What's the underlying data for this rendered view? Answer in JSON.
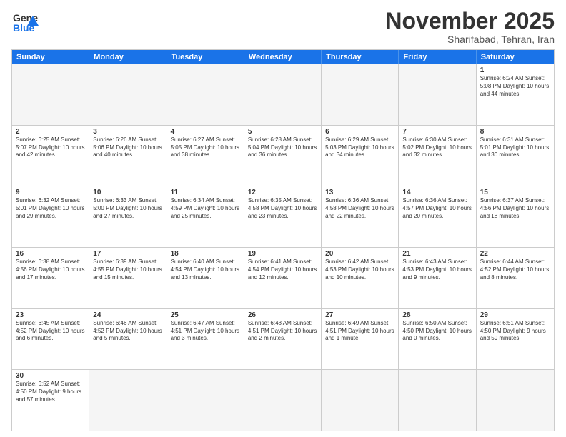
{
  "logo": {
    "line1": "General",
    "line2": "Blue"
  },
  "header": {
    "month": "November 2025",
    "location": "Sharifabad, Tehran, Iran"
  },
  "weekdays": [
    "Sunday",
    "Monday",
    "Tuesday",
    "Wednesday",
    "Thursday",
    "Friday",
    "Saturday"
  ],
  "weeks": [
    [
      {
        "day": "",
        "info": ""
      },
      {
        "day": "",
        "info": ""
      },
      {
        "day": "",
        "info": ""
      },
      {
        "day": "",
        "info": ""
      },
      {
        "day": "",
        "info": ""
      },
      {
        "day": "",
        "info": ""
      },
      {
        "day": "1",
        "info": "Sunrise: 6:24 AM\nSunset: 5:08 PM\nDaylight: 10 hours\nand 44 minutes."
      }
    ],
    [
      {
        "day": "2",
        "info": "Sunrise: 6:25 AM\nSunset: 5:07 PM\nDaylight: 10 hours\nand 42 minutes."
      },
      {
        "day": "3",
        "info": "Sunrise: 6:26 AM\nSunset: 5:06 PM\nDaylight: 10 hours\nand 40 minutes."
      },
      {
        "day": "4",
        "info": "Sunrise: 6:27 AM\nSunset: 5:05 PM\nDaylight: 10 hours\nand 38 minutes."
      },
      {
        "day": "5",
        "info": "Sunrise: 6:28 AM\nSunset: 5:04 PM\nDaylight: 10 hours\nand 36 minutes."
      },
      {
        "day": "6",
        "info": "Sunrise: 6:29 AM\nSunset: 5:03 PM\nDaylight: 10 hours\nand 34 minutes."
      },
      {
        "day": "7",
        "info": "Sunrise: 6:30 AM\nSunset: 5:02 PM\nDaylight: 10 hours\nand 32 minutes."
      },
      {
        "day": "8",
        "info": "Sunrise: 6:31 AM\nSunset: 5:01 PM\nDaylight: 10 hours\nand 30 minutes."
      }
    ],
    [
      {
        "day": "9",
        "info": "Sunrise: 6:32 AM\nSunset: 5:01 PM\nDaylight: 10 hours\nand 29 minutes."
      },
      {
        "day": "10",
        "info": "Sunrise: 6:33 AM\nSunset: 5:00 PM\nDaylight: 10 hours\nand 27 minutes."
      },
      {
        "day": "11",
        "info": "Sunrise: 6:34 AM\nSunset: 4:59 PM\nDaylight: 10 hours\nand 25 minutes."
      },
      {
        "day": "12",
        "info": "Sunrise: 6:35 AM\nSunset: 4:58 PM\nDaylight: 10 hours\nand 23 minutes."
      },
      {
        "day": "13",
        "info": "Sunrise: 6:36 AM\nSunset: 4:58 PM\nDaylight: 10 hours\nand 22 minutes."
      },
      {
        "day": "14",
        "info": "Sunrise: 6:36 AM\nSunset: 4:57 PM\nDaylight: 10 hours\nand 20 minutes."
      },
      {
        "day": "15",
        "info": "Sunrise: 6:37 AM\nSunset: 4:56 PM\nDaylight: 10 hours\nand 18 minutes."
      }
    ],
    [
      {
        "day": "16",
        "info": "Sunrise: 6:38 AM\nSunset: 4:56 PM\nDaylight: 10 hours\nand 17 minutes."
      },
      {
        "day": "17",
        "info": "Sunrise: 6:39 AM\nSunset: 4:55 PM\nDaylight: 10 hours\nand 15 minutes."
      },
      {
        "day": "18",
        "info": "Sunrise: 6:40 AM\nSunset: 4:54 PM\nDaylight: 10 hours\nand 13 minutes."
      },
      {
        "day": "19",
        "info": "Sunrise: 6:41 AM\nSunset: 4:54 PM\nDaylight: 10 hours\nand 12 minutes."
      },
      {
        "day": "20",
        "info": "Sunrise: 6:42 AM\nSunset: 4:53 PM\nDaylight: 10 hours\nand 10 minutes."
      },
      {
        "day": "21",
        "info": "Sunrise: 6:43 AM\nSunset: 4:53 PM\nDaylight: 10 hours\nand 9 minutes."
      },
      {
        "day": "22",
        "info": "Sunrise: 6:44 AM\nSunset: 4:52 PM\nDaylight: 10 hours\nand 8 minutes."
      }
    ],
    [
      {
        "day": "23",
        "info": "Sunrise: 6:45 AM\nSunset: 4:52 PM\nDaylight: 10 hours\nand 6 minutes."
      },
      {
        "day": "24",
        "info": "Sunrise: 6:46 AM\nSunset: 4:52 PM\nDaylight: 10 hours\nand 5 minutes."
      },
      {
        "day": "25",
        "info": "Sunrise: 6:47 AM\nSunset: 4:51 PM\nDaylight: 10 hours\nand 3 minutes."
      },
      {
        "day": "26",
        "info": "Sunrise: 6:48 AM\nSunset: 4:51 PM\nDaylight: 10 hours\nand 2 minutes."
      },
      {
        "day": "27",
        "info": "Sunrise: 6:49 AM\nSunset: 4:51 PM\nDaylight: 10 hours\nand 1 minute."
      },
      {
        "day": "28",
        "info": "Sunrise: 6:50 AM\nSunset: 4:50 PM\nDaylight: 10 hours\nand 0 minutes."
      },
      {
        "day": "29",
        "info": "Sunrise: 6:51 AM\nSunset: 4:50 PM\nDaylight: 9 hours\nand 59 minutes."
      }
    ],
    [
      {
        "day": "30",
        "info": "Sunrise: 6:52 AM\nSunset: 4:50 PM\nDaylight: 9 hours\nand 57 minutes."
      },
      {
        "day": "",
        "info": ""
      },
      {
        "day": "",
        "info": ""
      },
      {
        "day": "",
        "info": ""
      },
      {
        "day": "",
        "info": ""
      },
      {
        "day": "",
        "info": ""
      },
      {
        "day": "",
        "info": ""
      }
    ]
  ]
}
